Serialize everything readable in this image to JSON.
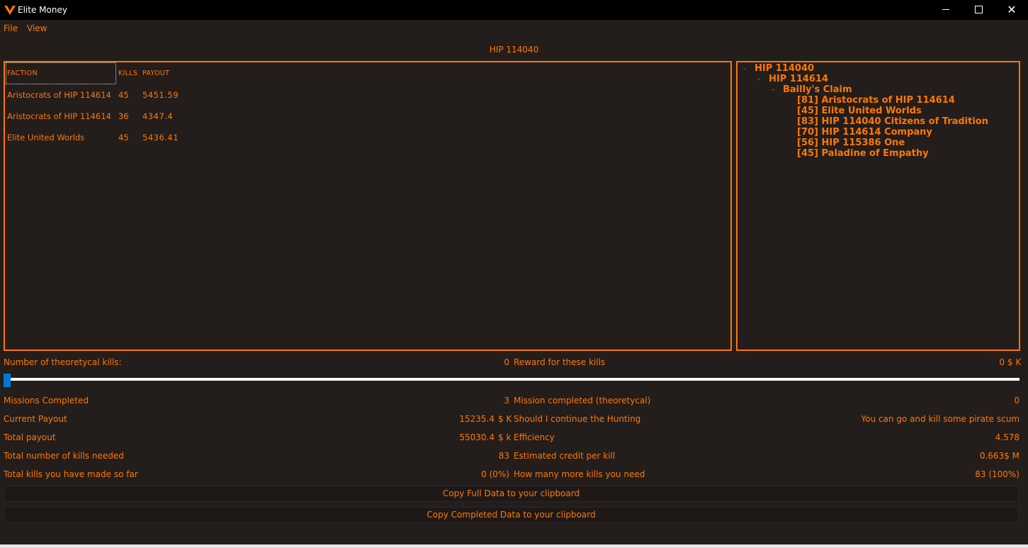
{
  "window": {
    "title": "Elite Money",
    "controls": {
      "minimize_icon": "minimize-icon",
      "maximize_icon": "maximize-icon",
      "close_icon": "close-icon",
      "close_glyph": "✕"
    }
  },
  "menu": {
    "file": "File",
    "view": "View"
  },
  "system_heading": "HIP 114040",
  "faction_table": {
    "headers": {
      "faction": "FACTION",
      "kills": "KILLS",
      "payout": "PAYOUT"
    },
    "rows": [
      {
        "faction": "Aristocrats of HIP 114614",
        "kills": "45",
        "payout": "5451.59"
      },
      {
        "faction": "Aristocrats of HIP 114614",
        "kills": "36",
        "payout": "4347.4"
      },
      {
        "faction": "Elite United Worlds",
        "kills": "45",
        "payout": "5436.41"
      }
    ]
  },
  "tree": {
    "root": "HIP 114040",
    "child": "HIP 114614",
    "station": "Bailly's Claim",
    "factions": [
      "[81] Aristocrats of HIP 114614",
      "[45] Elite United Worlds",
      "[83] HIP 114040 Citizens of Tradition",
      "[70] HIP 114614 Company",
      "[56] HIP 115386 One",
      "[45] Paladine of Empathy"
    ]
  },
  "theoretical": {
    "label": "Number of theoretycal kills:",
    "value": "0",
    "reward_label": "Reward for these kills",
    "reward_value": "0",
    "reward_unit": "$ K",
    "slider_value": 0
  },
  "stats_left": [
    {
      "label": "Missions Completed",
      "value": "3",
      "unit": ""
    },
    {
      "label": "Current Payout",
      "value": "15235.4",
      "unit": "$ K"
    },
    {
      "label": "Total payout",
      "value": "55030.4",
      "unit": "$ k"
    },
    {
      "label": "Total number of kills needed",
      "value": "83",
      "unit": ""
    },
    {
      "label": "Total kills you have made so far",
      "value": "0 (0%)",
      "unit": ""
    }
  ],
  "stats_right": [
    {
      "label": "Mission completed (theoretycal)",
      "value": "0"
    },
    {
      "label": "Should I continue the Hunting",
      "value": "You can go and kill some pirate scum"
    },
    {
      "label": "Efficiency",
      "value": "4.578"
    },
    {
      "label": "Estimated credit per kill",
      "value": "0.663$ M"
    },
    {
      "label": "How many more kills you need",
      "value": "83 (100%)"
    }
  ],
  "buttons": {
    "copy_full": "Copy Full Data to your clipboard",
    "copy_completed": "Copy Completed Data to your clipboard"
  },
  "colors": {
    "accent": "#ff7800",
    "background": "#231d1c",
    "titlebar": "#000000",
    "slider_thumb": "#0078d7"
  }
}
